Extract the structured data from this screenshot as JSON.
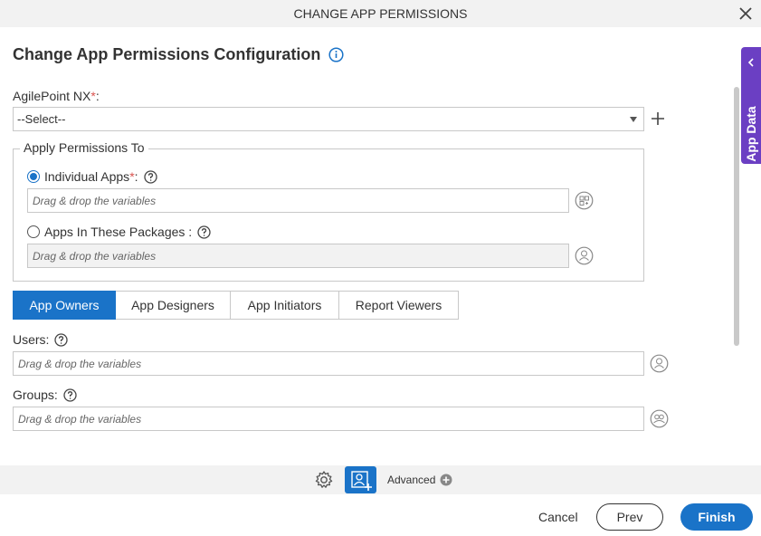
{
  "dialog": {
    "title": "CHANGE APP PERMISSIONS"
  },
  "form": {
    "heading": "Change App Permissions Configuration",
    "agilepoint_label": "AgilePoint NX",
    "required_mark": "*",
    "label_colon": ":",
    "select_value": "--Select--",
    "apply_legend": "Apply Permissions To",
    "individual_label": "Individual Apps",
    "individual_suffix": " :",
    "individual_selected": true,
    "packages_label": "Apps In These Packages :",
    "drop_placeholder": "Drag & drop the variables"
  },
  "tabs": [
    {
      "label": "App Owners",
      "active": true
    },
    {
      "label": "App Designers",
      "active": false
    },
    {
      "label": "App Initiators",
      "active": false
    },
    {
      "label": "Report Viewers",
      "active": false
    }
  ],
  "owners": {
    "users_label": "Users:",
    "groups_label": "Groups:"
  },
  "side_panel": {
    "label": "App Data"
  },
  "toolbar": {
    "advanced_label": "Advanced"
  },
  "footer": {
    "cancel": "Cancel",
    "prev": "Prev",
    "finish": "Finish"
  },
  "colors": {
    "accent": "#1a73c8",
    "side_panel": "#6b3fc3",
    "required": "#d9534f"
  },
  "icons": [
    "close-icon",
    "info-icon",
    "help-icon",
    "plus-icon",
    "variable-picker-icon",
    "gear-icon",
    "user-add-icon",
    "plus-circle-icon",
    "chevron-left-icon"
  ]
}
